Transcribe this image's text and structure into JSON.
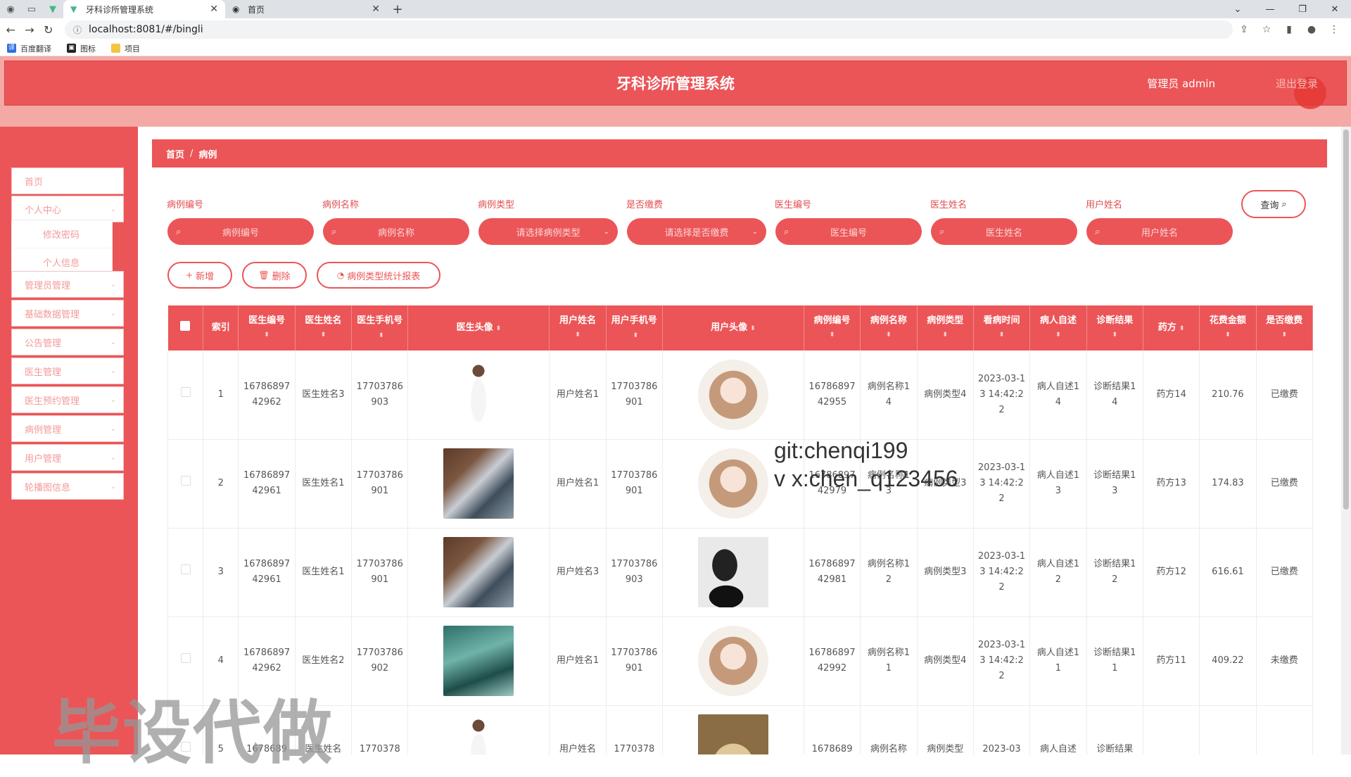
{
  "browser": {
    "tabs": [
      {
        "title": "牙科诊所管理系统",
        "active": true
      },
      {
        "title": "首页",
        "active": false
      }
    ],
    "url": "localhost:8081/#/bingli",
    "bookmarks": [
      "百度翻译",
      "图标",
      "项目"
    ]
  },
  "header": {
    "title": "牙科诊所管理系统",
    "user": "管理员 admin",
    "logout": "退出登录"
  },
  "sidebar": {
    "items": [
      {
        "label": "首页"
      },
      {
        "label": "个人中心"
      },
      {
        "label": "管理员管理"
      },
      {
        "label": "基础数据管理"
      },
      {
        "label": "公告管理"
      },
      {
        "label": "医生管理"
      },
      {
        "label": "医生预约管理"
      },
      {
        "label": "病例管理"
      },
      {
        "label": "用户管理"
      },
      {
        "label": "轮播图信息"
      }
    ],
    "submenu": [
      {
        "label": "修改密码"
      },
      {
        "label": "个人信息"
      }
    ]
  },
  "breadcrumb": {
    "home": "首页",
    "sep": "/",
    "current": "病例"
  },
  "filters": [
    {
      "label": "病例编号",
      "placeholder": "病例编号",
      "type": "input"
    },
    {
      "label": "病例名称",
      "placeholder": "病例名称",
      "type": "input"
    },
    {
      "label": "病例类型",
      "placeholder": "请选择病例类型",
      "type": "select"
    },
    {
      "label": "是否缴费",
      "placeholder": "请选择是否缴费",
      "type": "select"
    },
    {
      "label": "医生编号",
      "placeholder": "医生编号",
      "type": "input"
    },
    {
      "label": "医生姓名",
      "placeholder": "医生姓名",
      "type": "input"
    },
    {
      "label": "用户姓名",
      "placeholder": "用户姓名",
      "type": "input"
    }
  ],
  "query_label": "查询",
  "actions": {
    "add": "新增",
    "delete": "删除",
    "report": "病例类型统计报表"
  },
  "table": {
    "headers": {
      "index": "索引",
      "doctor_no": "医生编号",
      "doctor_name": "医生姓名",
      "doctor_phone": "医生手机号",
      "doctor_avatar": "医生头像",
      "user_name": "用户姓名",
      "user_phone": "用户手机号",
      "user_avatar": "用户头像",
      "case_no": "病例编号",
      "case_name": "病例名称",
      "case_type": "病例类型",
      "visit_time": "看病时间",
      "complaint": "病人自述",
      "diagnosis": "诊断结果",
      "prescription": "药方",
      "cost": "花费金额",
      "paid": "是否缴费"
    },
    "rows": [
      {
        "index": "1",
        "doctor_no": "1678689742962",
        "doctor_name": "医生姓名3",
        "doctor_phone": "17703786903",
        "doctor_img": "doctor-white",
        "user_name": "用户姓名1",
        "user_phone": "17703786901",
        "user_img": "avatar-girl",
        "case_no": "1678689742955",
        "case_name": "病例名称14",
        "case_type": "病例类型4",
        "visit_time": "2023-03-13 14:42:22",
        "complaint": "病人自述14",
        "diagnosis": "诊断结果14",
        "prescription": "药方14",
        "cost": "210.76",
        "paid": "已缴费"
      },
      {
        "index": "2",
        "doctor_no": "1678689742961",
        "doctor_name": "医生姓名1",
        "doctor_phone": "17703786901",
        "doctor_img": "doctor-xray",
        "user_name": "用户姓名1",
        "user_phone": "17703786901",
        "user_img": "avatar-girl",
        "case_no": "1678689742979",
        "case_name": "病例名称13",
        "case_type": "病例类型3",
        "visit_time": "2023-03-13 14:42:22",
        "complaint": "病人自述13",
        "diagnosis": "诊断结果13",
        "prescription": "药方13",
        "cost": "174.83",
        "paid": "已缴费"
      },
      {
        "index": "3",
        "doctor_no": "1678689742961",
        "doctor_name": "医生姓名1",
        "doctor_phone": "17703786901",
        "doctor_img": "doctor-xray",
        "user_name": "用户姓名3",
        "user_phone": "17703786903",
        "user_img": "avatar-dark",
        "case_no": "1678689742981",
        "case_name": "病例名称12",
        "case_type": "病例类型3",
        "visit_time": "2023-03-13 14:42:22",
        "complaint": "病人自述12",
        "diagnosis": "诊断结果12",
        "prescription": "药方12",
        "cost": "616.61",
        "paid": "已缴费"
      },
      {
        "index": "4",
        "doctor_no": "1678689742962",
        "doctor_name": "医生姓名2",
        "doctor_phone": "17703786902",
        "doctor_img": "doctor-surgery",
        "user_name": "用户姓名1",
        "user_phone": "17703786901",
        "user_img": "avatar-girl",
        "case_no": "1678689742992",
        "case_name": "病例名称11",
        "case_type": "病例类型4",
        "visit_time": "2023-03-13 14:42:22",
        "complaint": "病人自述11",
        "diagnosis": "诊断结果11",
        "prescription": "药方11",
        "cost": "409.22",
        "paid": "未缴费"
      },
      {
        "index": "5",
        "doctor_no": "1678689",
        "doctor_name": "医生姓名",
        "doctor_phone": "1770378",
        "doctor_img": "doctor-white",
        "user_name": "用户姓名",
        "user_phone": "1770378",
        "user_img": "avatar-gold",
        "case_no": "1678689",
        "case_name": "病例名称",
        "case_type": "病例类型",
        "visit_time": "2023-03",
        "complaint": "病人自述",
        "diagnosis": "诊断结果",
        "prescription": "",
        "cost": "",
        "paid": ""
      }
    ]
  },
  "watermarks": {
    "code_line1": "git:chenqi199",
    "code_line2": "v x:chen_q123456",
    "big": "毕设代做"
  },
  "colors": {
    "primary": "#eb5557",
    "primary_light": "#f4a9a4"
  }
}
